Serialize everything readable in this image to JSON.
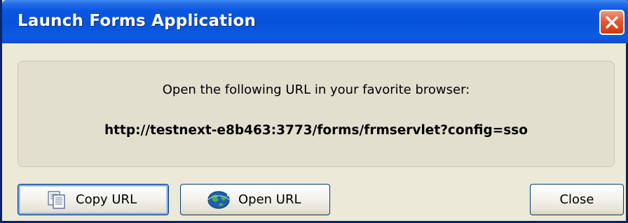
{
  "window": {
    "title": "Launch Forms Application",
    "close_icon": "close-x-icon"
  },
  "message": {
    "instruction": "Open the following URL in your favorite browser:",
    "url": "http://testnext-e8b463:3773/forms/frmservlet?config=sso"
  },
  "buttons": {
    "copy_url": {
      "label": "Copy URL",
      "icon": "copy-icon"
    },
    "open_url": {
      "label": "Open URL",
      "icon": "globe-icon"
    },
    "close": {
      "label": "Close"
    }
  },
  "colors": {
    "titlebar": "#0752d9",
    "close_button": "#e4582f",
    "dialog_background": "#ece9d8"
  }
}
